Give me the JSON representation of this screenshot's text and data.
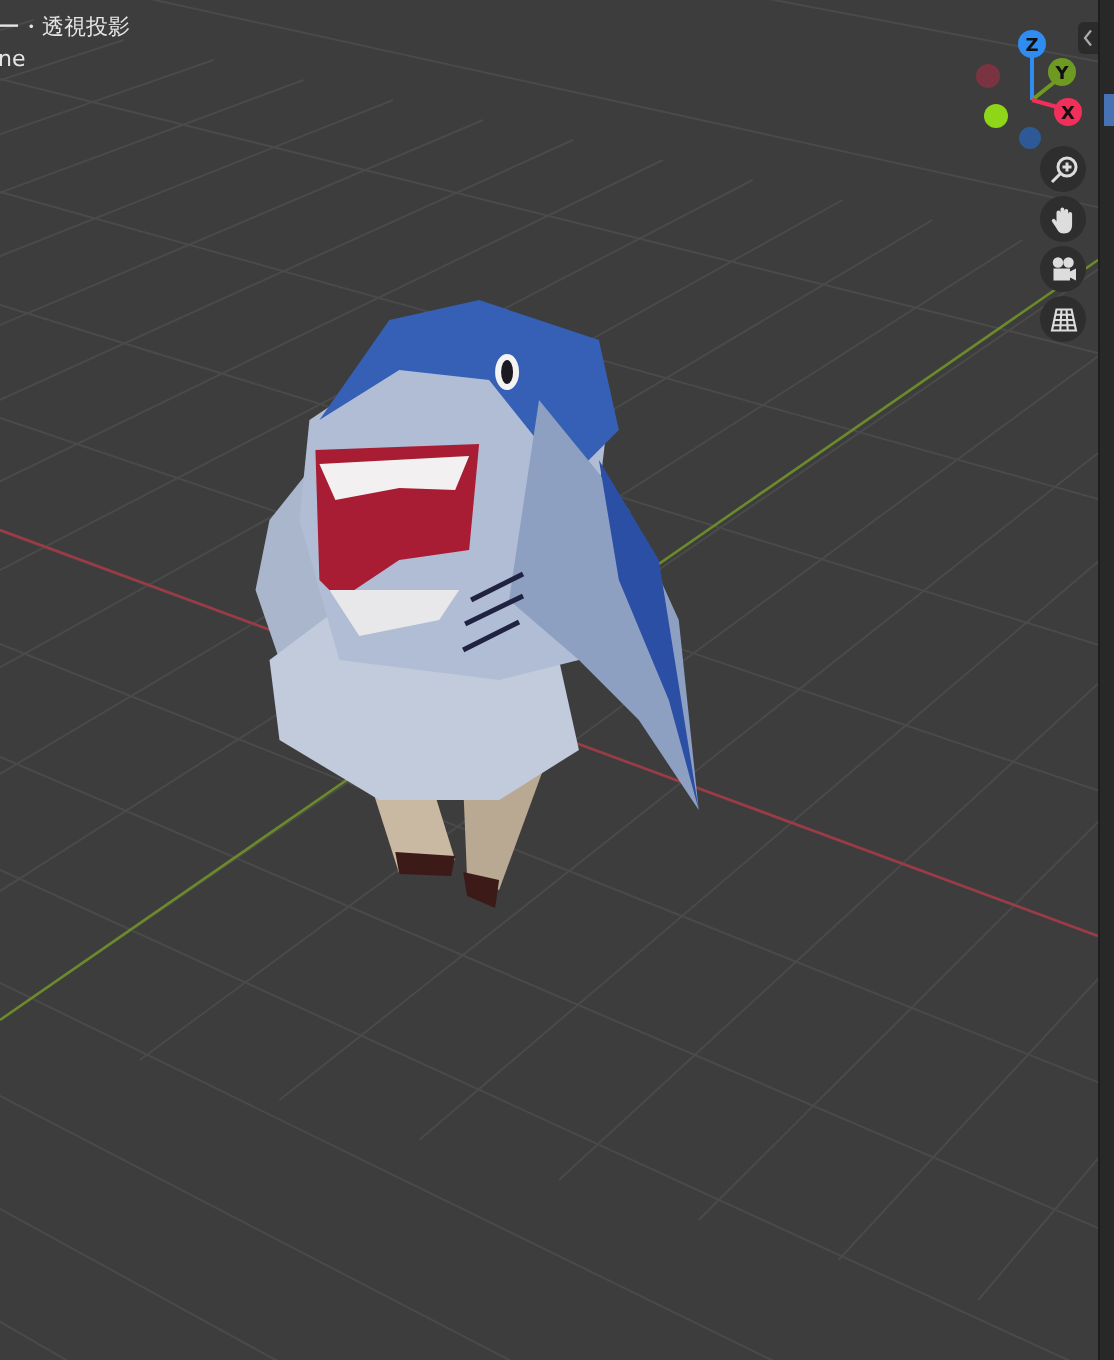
{
  "viewport": {
    "view_name": "ー・透視投影",
    "collection_name": "ne"
  },
  "gizmo": {
    "axes": [
      {
        "label": "Z",
        "color": "#2f8cf0"
      },
      {
        "label": "Y",
        "color": "#6f9a22"
      },
      {
        "label": "X",
        "color": "#f0305a"
      }
    ]
  }
}
